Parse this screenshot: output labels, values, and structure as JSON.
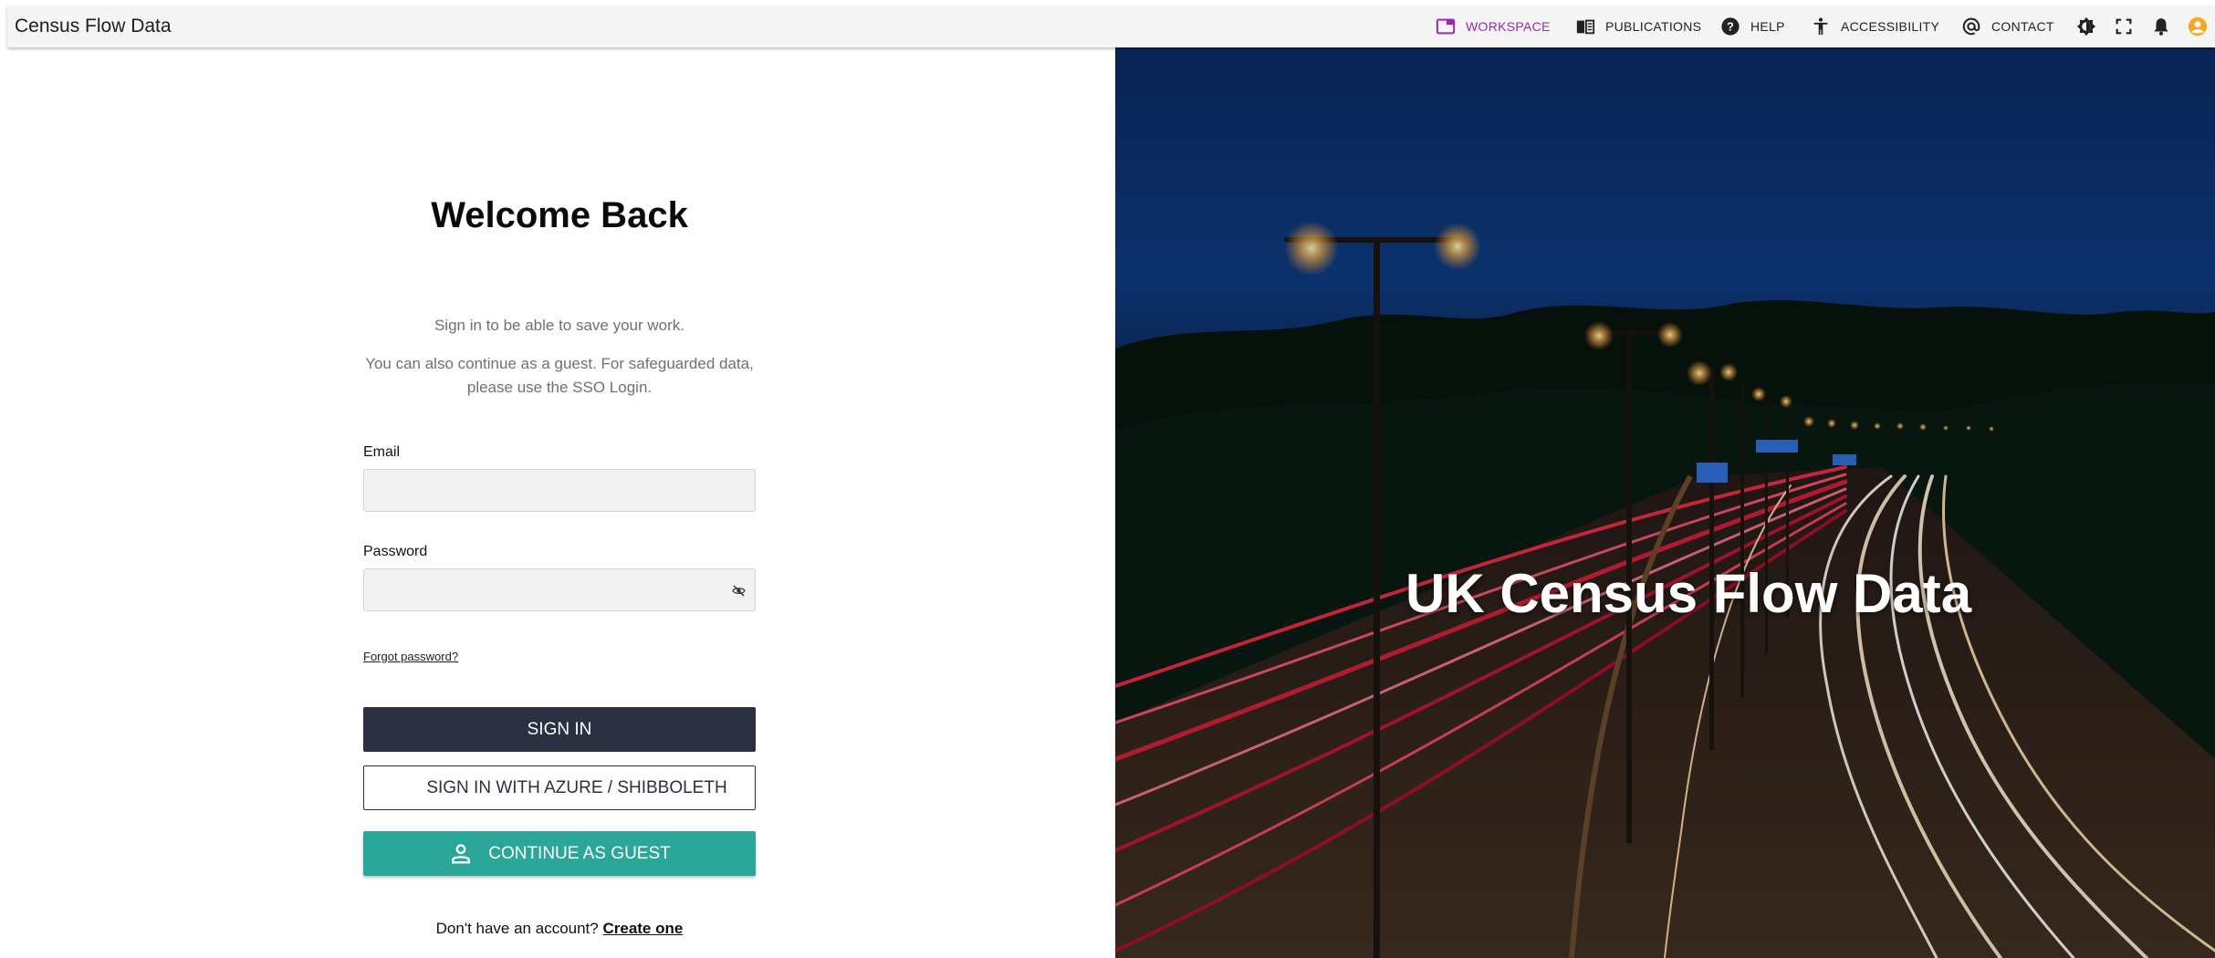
{
  "app": {
    "title": "Census Flow Data"
  },
  "nav": {
    "workspace": "WORKSPACE",
    "publications": "PUBLICATIONS",
    "help": "HELP",
    "accessibility": "ACCESSIBILITY",
    "contact": "CONTACT",
    "active_color": "#9c27b0"
  },
  "icons": [
    "workspace-icon",
    "publications-icon",
    "help-icon",
    "accessibility-icon",
    "contact-icon",
    "theme-toggle-icon",
    "fullscreen-icon",
    "notifications-icon",
    "account-icon"
  ],
  "login": {
    "heading": "Welcome Back",
    "subtitle": "Sign in to be able to save your work.",
    "note_line1": "You can also continue as a guest. For safeguarded data,",
    "note_line2": "please use the SSO Login.",
    "email_label": "Email",
    "email_value": "",
    "password_label": "Password",
    "password_value": "",
    "forgot": "Forgot password?",
    "sign_in": "SIGN IN",
    "sign_in_sso": "SIGN IN WITH AZURE / SHIBBOLETH",
    "guest": "CONTINUE AS GUEST",
    "no_account": "Don't have an account?",
    "create": "Create one"
  },
  "hero": {
    "title": "UK Census Flow Data"
  },
  "colors": {
    "signin_bg": "#2b3140",
    "guest_bg": "#2aa798",
    "account_icon": "#f5a623"
  }
}
